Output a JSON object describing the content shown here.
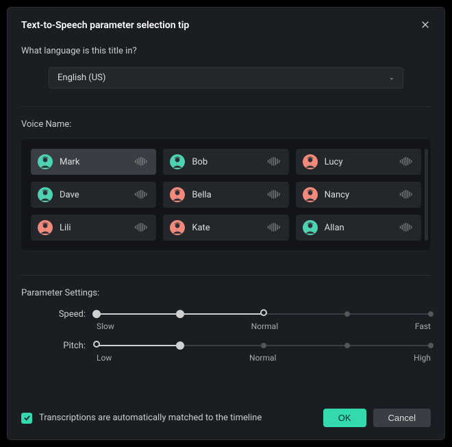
{
  "dialog": {
    "title": "Text-to-Speech parameter selection tip",
    "close_icon": "close-icon"
  },
  "language": {
    "question": "What language is this title in?",
    "selected": "English (US)"
  },
  "voices": {
    "label": "Voice Name:",
    "items": [
      {
        "name": "Mark",
        "avatar_color": "#4fd1b3",
        "selected": true
      },
      {
        "name": "Bob",
        "avatar_color": "#4fd1b3",
        "selected": false
      },
      {
        "name": "Lucy",
        "avatar_color": "#f18a7a",
        "selected": false
      },
      {
        "name": "Dave",
        "avatar_color": "#4fd1b3",
        "selected": false
      },
      {
        "name": "Bella",
        "avatar_color": "#f18a7a",
        "selected": false
      },
      {
        "name": "Nancy",
        "avatar_color": "#f18a7a",
        "selected": false
      },
      {
        "name": "Lili",
        "avatar_color": "#f18a7a",
        "selected": false
      },
      {
        "name": "Kate",
        "avatar_color": "#f18a7a",
        "selected": false
      },
      {
        "name": "Allan",
        "avatar_color": "#4fd1b3",
        "selected": false
      }
    ]
  },
  "parameters": {
    "label": "Parameter Settings:",
    "speed": {
      "label": "Speed:",
      "min_label": "Slow",
      "mid_label": "Normal",
      "max_label": "Fast",
      "value_pct": 50,
      "mid_pct": 50
    },
    "pitch": {
      "label": "Pitch:",
      "min_label": "Low",
      "mid_label": "Normal",
      "max_label": "High",
      "value_pct": 25,
      "mid_pct": 50
    }
  },
  "footer": {
    "checkbox_checked": true,
    "checkbox_label": "Transcriptions are automatically matched to the timeline",
    "ok_label": "OK",
    "cancel_label": "Cancel"
  },
  "colors": {
    "accent": "#35d9b0"
  }
}
